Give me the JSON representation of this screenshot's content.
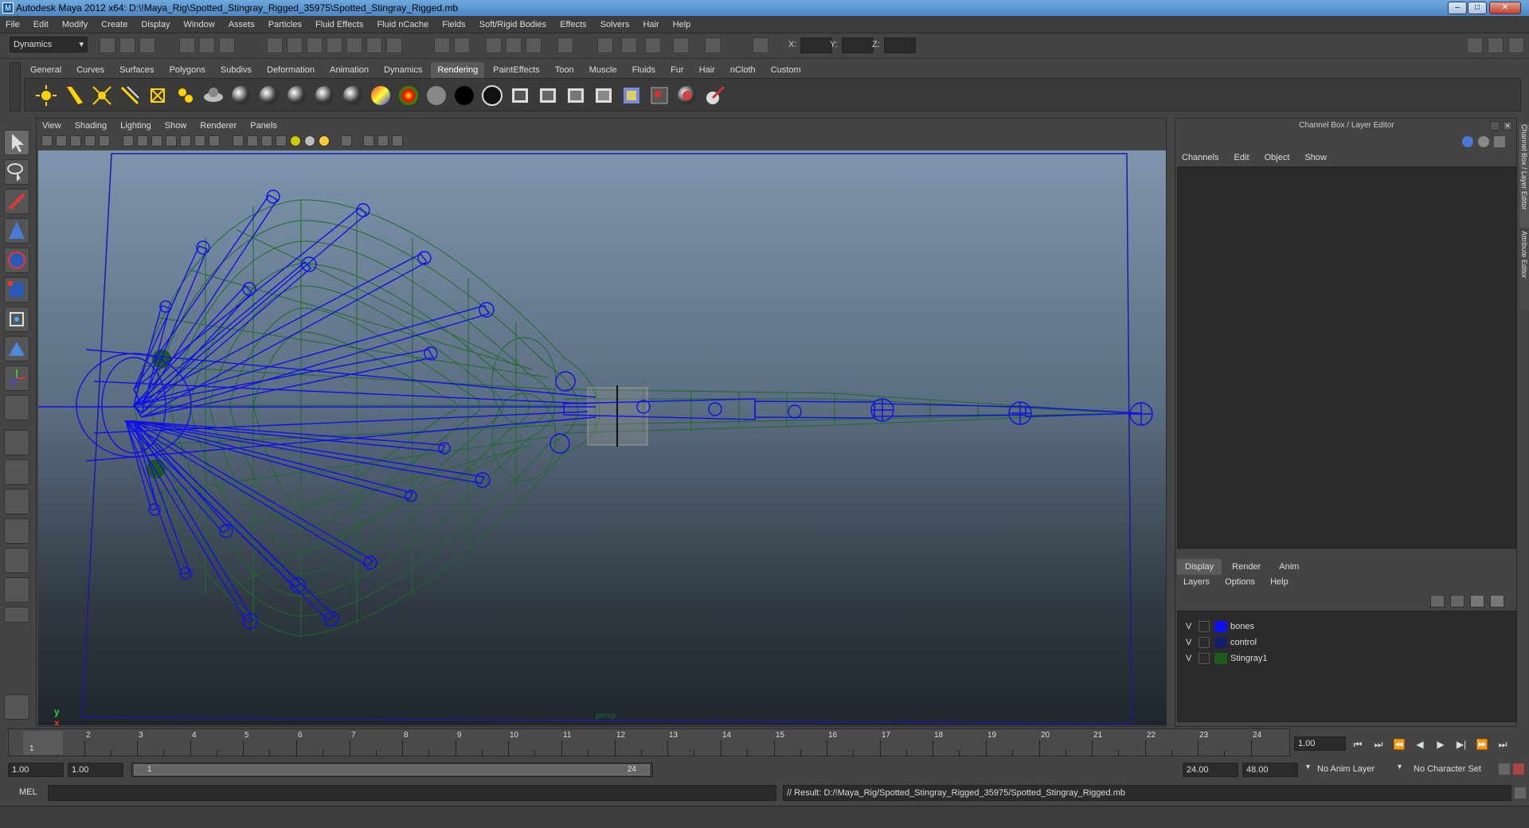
{
  "window": {
    "title": "Autodesk Maya 2012 x64: D:\\!Maya_Rig\\Spotted_Stingray_Rigged_35975\\Spotted_Stingray_Rigged.mb",
    "app_icon": "M"
  },
  "window_controls": {
    "minimize": "–",
    "maximize": "□",
    "close": "✕"
  },
  "menubar": [
    "File",
    "Edit",
    "Modify",
    "Create",
    "Display",
    "Window",
    "Assets",
    "Particles",
    "Fluid Effects",
    "Fluid nCache",
    "Fields",
    "Soft/Rigid Bodies",
    "Effects",
    "Solvers",
    "Hair",
    "Help"
  ],
  "statusline": {
    "menuset": "Dynamics",
    "x_label": "X:",
    "y_label": "Y:",
    "z_label": "Z:"
  },
  "shelf_tabs": [
    "General",
    "Curves",
    "Surfaces",
    "Polygons",
    "Subdivs",
    "Deformation",
    "Animation",
    "Dynamics",
    "Rendering",
    "PaintEffects",
    "Toon",
    "Muscle",
    "Fluids",
    "Fur",
    "Hair",
    "nCloth",
    "Custom"
  ],
  "shelf_active": "Rendering",
  "shelf_icons": [
    "point-light-icon",
    "spot-light-icon",
    "area-light-icon",
    "directional-light-icon",
    "volume-light-icon",
    "ambient-light-icon",
    "lambert-sphere-icon",
    "blinn-sphere-icon",
    "phong-sphere-icon",
    "phonge-sphere-icon",
    "anisotropic-sphere-icon",
    "ramp-shader-icon",
    "layered-shader-icon",
    "surface-shader-icon",
    "black-sphere-icon",
    "use-background-icon",
    "render-icon",
    "ipr-render-icon",
    "batch-render-icon",
    "render-view-icon",
    "hypershade-icon",
    "render-settings-icon",
    "mental-ray-icon",
    "paint-icon"
  ],
  "viewport": {
    "menu": [
      "View",
      "Shading",
      "Lighting",
      "Show",
      "Renderer",
      "Panels"
    ],
    "camera": "persp",
    "axis_x": "x",
    "axis_y": "y"
  },
  "channelbox": {
    "title": "Channel Box / Layer Editor",
    "menu": [
      "Channels",
      "Edit",
      "Object",
      "Show"
    ],
    "layer_tabs": [
      "Display",
      "Render",
      "Anim"
    ],
    "active_layer_tab": "Display",
    "layer_menu": [
      "Layers",
      "Options",
      "Help"
    ],
    "layers": [
      {
        "visible": "V",
        "name": "bones",
        "color": "#1010e8"
      },
      {
        "visible": "V",
        "name": "control",
        "color": "#141e6a"
      },
      {
        "visible": "V",
        "name": "Stingray1",
        "color": "#1e5a1e"
      }
    ]
  },
  "side_tabs": [
    "Channel Box / Layer Editor",
    "Attribute Editor"
  ],
  "timeslider": {
    "ticks": [
      "1",
      "2",
      "3",
      "4",
      "5",
      "6",
      "7",
      "8",
      "9",
      "10",
      "11",
      "12",
      "13",
      "14",
      "15",
      "16",
      "17",
      "18",
      "19",
      "20",
      "21",
      "22",
      "23",
      "24"
    ],
    "current_frame": "1",
    "current_time": "1.00"
  },
  "range": {
    "start_time": "1.00",
    "playback_start": "1.00",
    "range_start": "1",
    "range_end": "24",
    "playback_end": "24.00",
    "end_time": "48.00",
    "anim_layer": "No Anim Layer",
    "character_set": "No Character Set"
  },
  "playback_controls": [
    "⏮",
    "⏭",
    "⏪",
    "◀",
    "▶",
    "▶|",
    "⏩",
    "⏭"
  ],
  "cmdline": {
    "language": "MEL",
    "result": "// Result: D:/!Maya_Rig/Spotted_Stingray_Rigged_35975/Spotted_Stingray_Rigged.mb"
  },
  "colors": {
    "bones": "#1010e8",
    "mesh": "#1e6a2a",
    "accent": "#4a86c5"
  }
}
